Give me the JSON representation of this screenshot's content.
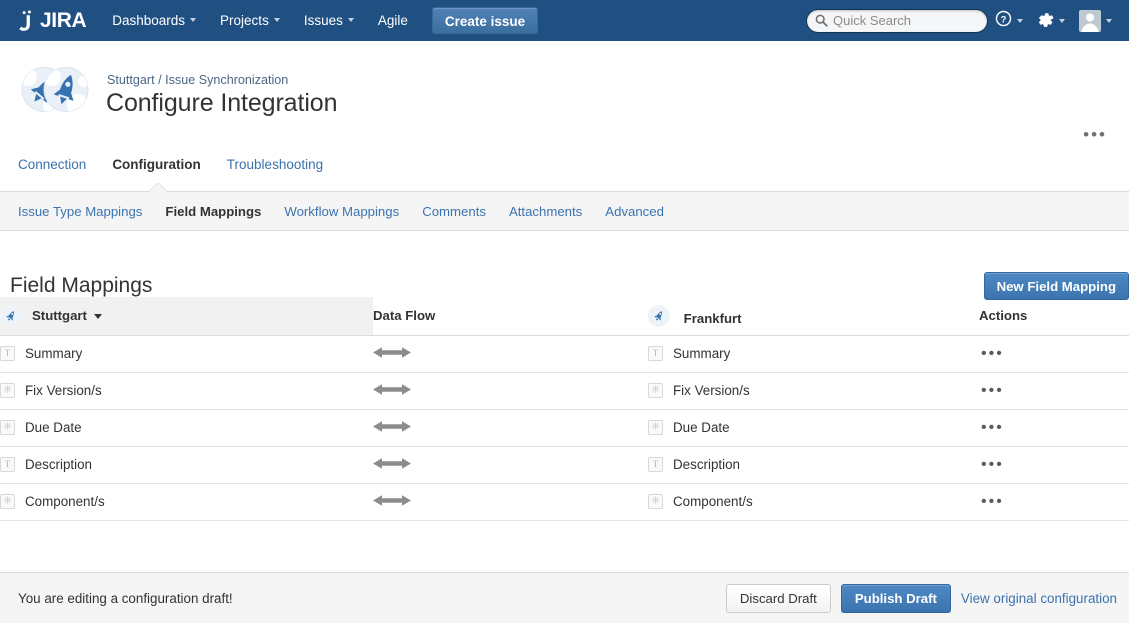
{
  "topnav": {
    "logo_text": "JIRA",
    "logo_icon": "jira-logo-icon",
    "items": [
      {
        "label": "Dashboards",
        "has_caret": true
      },
      {
        "label": "Projects",
        "has_caret": true
      },
      {
        "label": "Issues",
        "has_caret": true
      },
      {
        "label": "Agile",
        "has_caret": false
      }
    ],
    "create_button": "Create issue",
    "search": {
      "value": "",
      "placeholder": "Quick Search",
      "icon": "search-icon"
    },
    "help_icon": "help-circle-icon",
    "settings_icon": "gear-icon",
    "profile_icon": "user-avatar-icon"
  },
  "header": {
    "avatar_icon": "rocket-pair-icon",
    "breadcrumb": "Stuttgart / Issue Synchronization",
    "title": "Configure Integration",
    "more_icon": "ellipsis-icon",
    "more_label": "•••"
  },
  "tabs": [
    {
      "label": "Connection",
      "active": false
    },
    {
      "label": "Configuration",
      "active": true
    },
    {
      "label": "Troubleshooting",
      "active": false
    }
  ],
  "subtabs": [
    {
      "label": "Issue Type Mappings",
      "active": false
    },
    {
      "label": "Field Mappings",
      "active": true
    },
    {
      "label": "Workflow Mappings",
      "active": false
    },
    {
      "label": "Comments",
      "active": false
    },
    {
      "label": "Attachments",
      "active": false
    },
    {
      "label": "Advanced",
      "active": false
    }
  ],
  "section": {
    "title": "Field Mappings",
    "new_button": "New Field Mapping"
  },
  "table": {
    "columns": [
      {
        "key": "source",
        "label": "Stuttgart",
        "icon": "rocket-icon",
        "sorted": true,
        "sort_indicator": "▼",
        "highlighted": true
      },
      {
        "key": "flow",
        "label": "Data Flow",
        "icon": null,
        "highlighted": false
      },
      {
        "key": "target",
        "label": "Frankfurt",
        "icon": "rocket-icon",
        "highlighted": false
      },
      {
        "key": "actions",
        "label": "Actions",
        "icon": null,
        "highlighted": false
      }
    ],
    "rows": [
      {
        "source": "Summary",
        "source_icon": "text-field-icon",
        "source_glyph": "T",
        "flow": "bidirectional-arrow-icon",
        "target": "Summary",
        "target_icon": "text-field-icon",
        "target_glyph": "T",
        "actions": "•••"
      },
      {
        "source": "Fix Version/s",
        "source_icon": "generic-field-icon",
        "source_glyph": "✳",
        "flow": "bidirectional-arrow-icon",
        "target": "Fix Version/s",
        "target_icon": "generic-field-icon",
        "target_glyph": "✳",
        "actions": "•••"
      },
      {
        "source": "Due Date",
        "source_icon": "generic-field-icon",
        "source_glyph": "✳",
        "flow": "bidirectional-arrow-icon",
        "target": "Due Date",
        "target_icon": "generic-field-icon",
        "target_glyph": "✳",
        "actions": "•••"
      },
      {
        "source": "Description",
        "source_icon": "text-field-icon",
        "source_glyph": "T",
        "flow": "bidirectional-arrow-icon",
        "target": "Description",
        "target_icon": "text-field-icon",
        "target_glyph": "T",
        "actions": "•••"
      },
      {
        "source": "Component/s",
        "source_icon": "generic-field-icon",
        "source_glyph": "✳",
        "flow": "bidirectional-arrow-icon",
        "target": "Component/s",
        "target_icon": "generic-field-icon",
        "target_glyph": "✳",
        "actions": "•••"
      }
    ]
  },
  "footer": {
    "message": "You are editing a configuration draft!",
    "discard_button": "Discard Draft",
    "publish_button": "Publish Draft",
    "view_original_link": "View original configuration"
  },
  "colors": {
    "nav_background": "#205081",
    "link_blue": "#3b73af",
    "breadcrumb_blue": "#4a6785",
    "primary_button": "#3b73af",
    "header_highlight": "#f1f1f1",
    "footer_background": "#f5f5f5",
    "text_dark": "#333333",
    "arrow_gray": "#8c8c8c",
    "rocket_blue": "#3572b0"
  }
}
